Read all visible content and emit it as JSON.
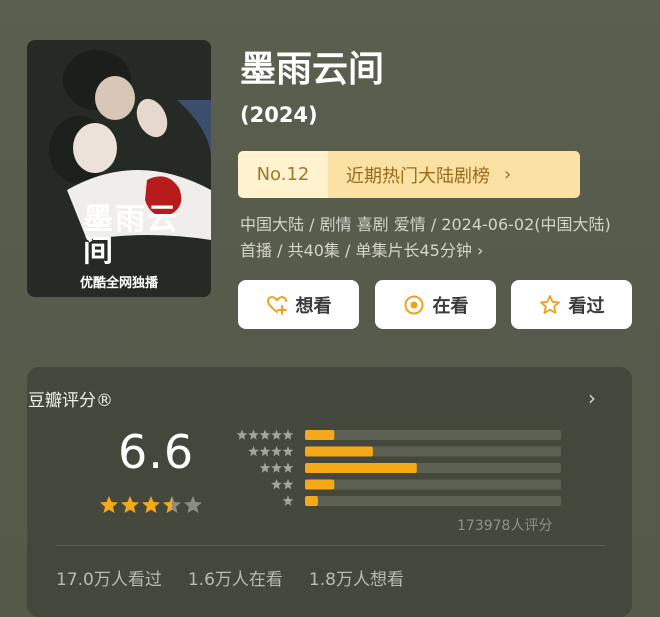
{
  "poster": {
    "title": "墨雨云间",
    "badge": "优酷全网独播"
  },
  "title": "墨雨云间",
  "year": "(2024)",
  "rank": {
    "number": "No.12",
    "label": "近期热门大陆剧榜"
  },
  "meta": "中国大陆 / 剧情 喜剧 爱情 / 2024-06-02(中国大陆)首播 / 共40集 / 单集片长45分钟",
  "actions": {
    "want": "想看",
    "watching": "在看",
    "watched": "看过"
  },
  "rating": {
    "title": "豆瓣评分®",
    "score": "6.6",
    "stars": 3.5,
    "total": "173978人评分",
    "distribution": [
      {
        "stars": 5,
        "percent": 10.4
      },
      {
        "stars": 4,
        "percent": 24.1
      },
      {
        "stars": 3,
        "percent": 39.7
      },
      {
        "stars": 2,
        "percent": 10.4
      },
      {
        "stars": 1,
        "percent": 4.6
      }
    ],
    "stats": [
      "17.0万人看过",
      "1.6万人在看",
      "1.8万人想看"
    ]
  },
  "colors": {
    "accent": "#f5a818",
    "track": "#5d6154",
    "rank_bg": "#fbe1a4",
    "rank_text": "#9a6a19"
  }
}
